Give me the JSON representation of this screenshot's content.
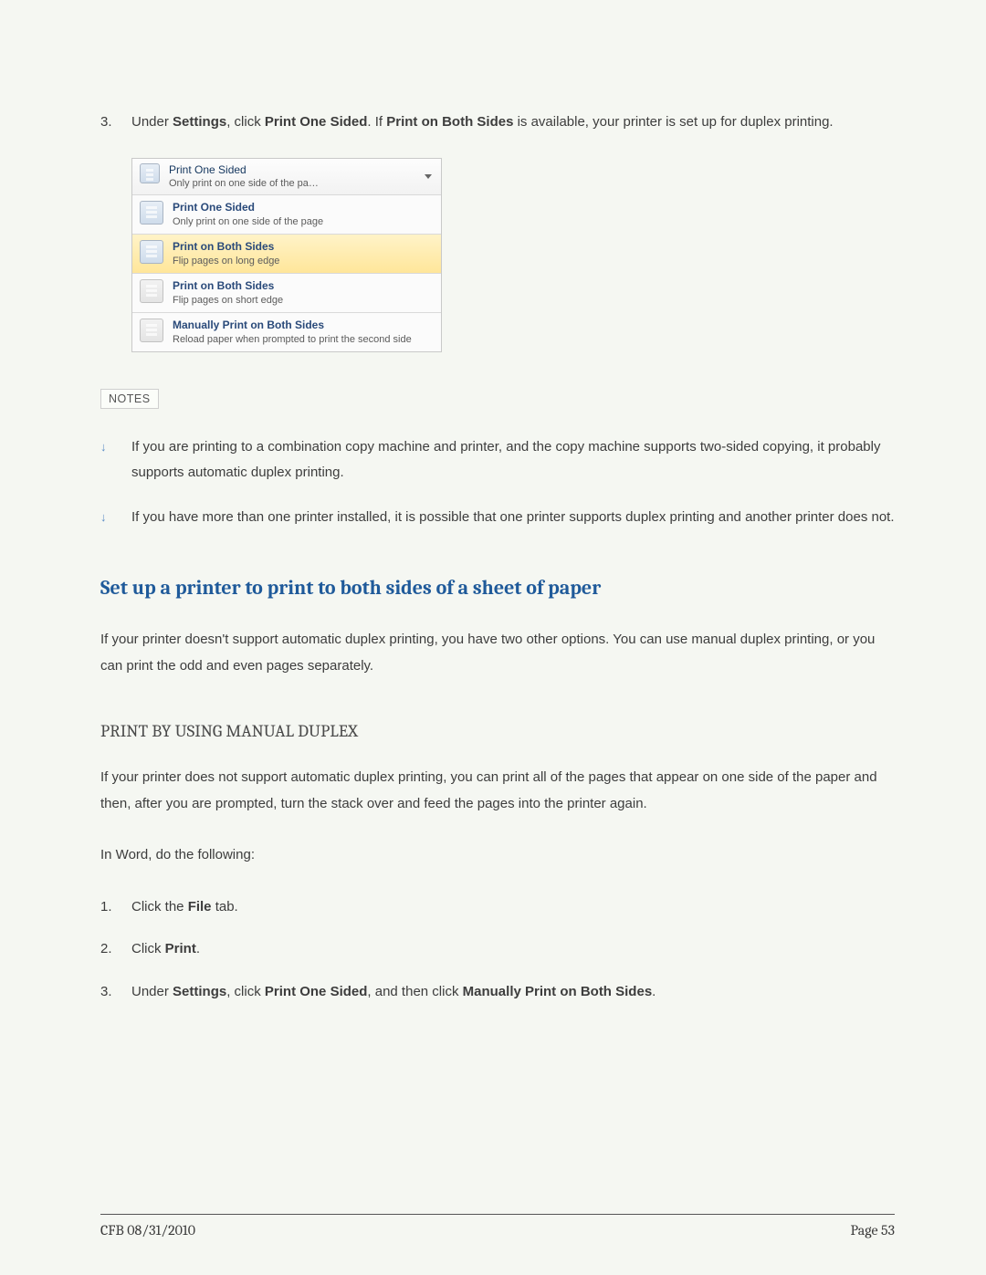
{
  "step3": {
    "num": "3.",
    "t1": "Under ",
    "b1": "Settings",
    "t2": ", click ",
    "b2": "Print One Sided",
    "t3": ". If ",
    "b3": "Print on Both Sides",
    "t4": " is available, your printer is set up for duplex printing."
  },
  "dropdown": {
    "top": {
      "title": "Print One Sided",
      "desc": "Only print on one side of the pa…"
    },
    "rows": [
      {
        "title": "Print One Sided",
        "desc": "Only print on one side of the page"
      },
      {
        "title": "Print on Both Sides",
        "desc": "Flip pages on long edge"
      },
      {
        "title": "Print on Both Sides",
        "desc": "Flip pages on short edge"
      },
      {
        "title": "Manually Print on Both Sides",
        "desc": "Reload paper when prompted to print the second side"
      }
    ]
  },
  "notes_label": "NOTES",
  "notes": [
    "If you are printing to a combination copy machine and printer, and the copy machine supports two-sided copying, it probably supports automatic duplex printing.",
    "If you have more than one printer installed, it is possible that one printer supports duplex printing and another printer does not."
  ],
  "section_title": "Set up a printer to print to both sides of a sheet of paper",
  "section_para": "If your printer doesn't support automatic duplex printing, you have two other options. You can use manual duplex printing, or you can print the odd and even pages separately.",
  "sub_title": "PRINT BY USING MANUAL DUPLEX",
  "sub_para": "If your printer does not support automatic duplex printing, you can print all of the pages that appear on one side of the paper and then, after you are prompted, turn the stack over and feed the pages into the printer again.",
  "sub_para2": "In Word, do the following:",
  "steps2": {
    "s1": {
      "num": "1.",
      "t1": "Click the ",
      "b1": "File",
      "t2": " tab."
    },
    "s2": {
      "num": "2.",
      "t1": "Click ",
      "b1": "Print",
      "t2": "."
    },
    "s3": {
      "num": "3.",
      "t1": "Under ",
      "b1": "Settings",
      "t2": ", click ",
      "b2": "Print One Sided",
      "t3": ", and then click ",
      "b3": "Manually Print on Both Sides",
      "t4": "."
    }
  },
  "footer": {
    "left": "CFB 08/31/2010",
    "right": "Page 53"
  }
}
